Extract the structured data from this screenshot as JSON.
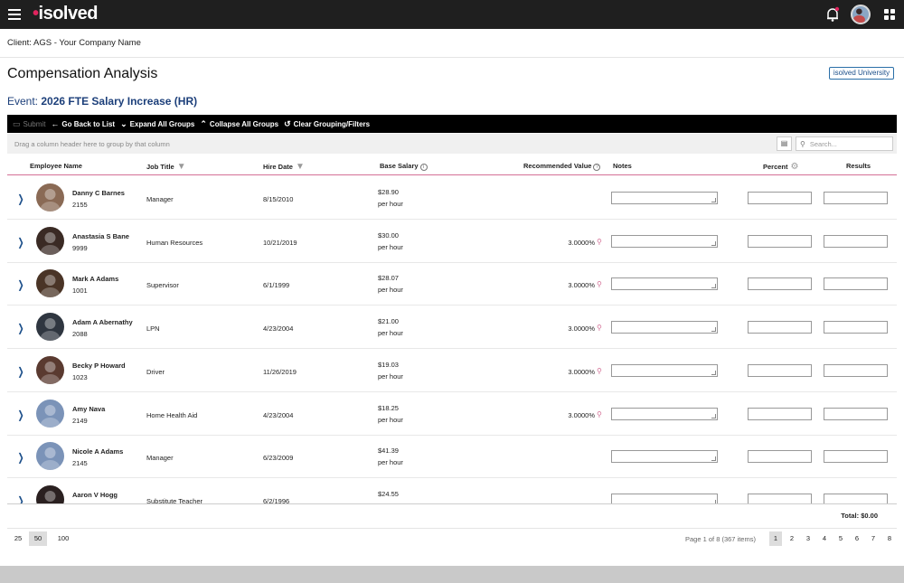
{
  "app": {
    "logo": "isolved"
  },
  "client": {
    "label": "Client: AGS - Your Company Name"
  },
  "page": {
    "title": "Compensation Analysis",
    "university_link": "isolved University"
  },
  "event": {
    "label": "Event:",
    "name": "2026 FTE Salary Increase (HR)"
  },
  "toolbar": {
    "submit": "Submit",
    "go_back": "Go Back to List",
    "expand": "Expand All Groups",
    "collapse": "Collapse All Groups",
    "clear": "Clear Grouping/Filters"
  },
  "grid": {
    "group_hint": "Drag a column header here to group by that column",
    "search_placeholder": "Search...",
    "columns": {
      "employee": "Employee Name",
      "job": "Job Title",
      "hire": "Hire Date",
      "salary": "Base Salary",
      "recommended": "Recommended Value",
      "notes": "Notes",
      "percent": "Percent",
      "results": "Results"
    },
    "rows": [
      {
        "name": "Danny C Barnes",
        "id": "2155",
        "job": "Manager",
        "hire": "8/15/2010",
        "salary": "$28.90",
        "unit": "per hour",
        "rec": "",
        "avatar_color": "#8a6a55"
      },
      {
        "name": "Anastasia S Bane",
        "id": "9999",
        "job": "Human Resources",
        "hire": "10/21/2019",
        "salary": "$30.00",
        "unit": "per hour",
        "rec": "3.0000%",
        "avatar_color": "#3a2a24"
      },
      {
        "name": "Mark A Adams",
        "id": "1001",
        "job": "Supervisor",
        "hire": "6/1/1999",
        "salary": "$28.07",
        "unit": "per hour",
        "rec": "3.0000%",
        "avatar_color": "#4a3426"
      },
      {
        "name": "Adam A Abernathy",
        "id": "2088",
        "job": "LPN",
        "hire": "4/23/2004",
        "salary": "$21.00",
        "unit": "per hour",
        "rec": "3.0000%",
        "avatar_color": "#2f3640"
      },
      {
        "name": "Becky P Howard",
        "id": "1023",
        "job": "Driver",
        "hire": "11/26/2019",
        "salary": "$19.03",
        "unit": "per hour",
        "rec": "3.0000%",
        "avatar_color": "#5a3a30"
      },
      {
        "name": "Amy Nava",
        "id": "2149",
        "job": "Home Health Aid",
        "hire": "4/23/2004",
        "salary": "$18.25",
        "unit": "per hour",
        "rec": "3.0000%",
        "avatar_color": "#7b93b8"
      },
      {
        "name": "Nicole A Adams",
        "id": "2145",
        "job": "Manager",
        "hire": "6/23/2009",
        "salary": "$41.39",
        "unit": "per hour",
        "rec": "",
        "avatar_color": "#7b93b8"
      },
      {
        "name": "Aaron V Hogg",
        "id": "",
        "job": "Substitute Teacher",
        "hire": "6/2/1996",
        "salary": "$24.55",
        "unit": "",
        "rec": "",
        "avatar_color": "#2a2020"
      }
    ],
    "total": "Total: $0.00"
  },
  "pager": {
    "sizes": [
      "25",
      "50",
      "100"
    ],
    "selected_size": "50",
    "info": "Page 1 of 8 (367 items)",
    "pages": [
      "1",
      "2",
      "3",
      "4",
      "5",
      "6",
      "7",
      "8"
    ],
    "current_page": "1"
  }
}
